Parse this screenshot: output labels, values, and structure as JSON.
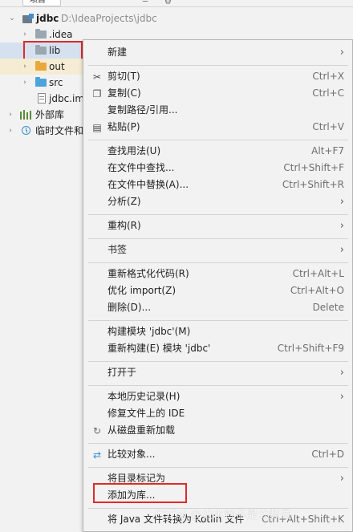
{
  "project": {
    "tab_label": "项目",
    "root": {
      "name": "jdbc",
      "path": "D:\\IdeaProjects\\jdbc"
    },
    "items": [
      {
        "label": ".idea"
      },
      {
        "label": "lib"
      },
      {
        "label": "out"
      },
      {
        "label": "src"
      },
      {
        "label": "jdbc.im"
      }
    ],
    "external_libs": "外部库",
    "scratches": "临时文件和"
  },
  "context_menu": {
    "items": [
      {
        "label": "新建"
      },
      {
        "label": "剪切(T)",
        "shortcut": "Ctrl+X"
      },
      {
        "label": "复制(C)",
        "shortcut": "Ctrl+C"
      },
      {
        "label": "复制路径/引用..."
      },
      {
        "label": "粘贴(P)",
        "shortcut": "Ctrl+V"
      },
      {
        "label": "查找用法(U)",
        "shortcut": "Alt+F7"
      },
      {
        "label": "在文件中查找...",
        "shortcut": "Ctrl+Shift+F"
      },
      {
        "label": "在文件中替换(A)...",
        "shortcut": "Ctrl+Shift+R"
      },
      {
        "label": "分析(Z)"
      },
      {
        "label": "重构(R)"
      },
      {
        "label": "书签"
      },
      {
        "label": "重新格式化代码(R)",
        "shortcut": "Ctrl+Alt+L"
      },
      {
        "label": "优化 import(Z)",
        "shortcut": "Ctrl+Alt+O"
      },
      {
        "label": "删除(D)...",
        "shortcut": "Delete"
      },
      {
        "label": "构建模块 'jdbc'(M)"
      },
      {
        "label": "重新构建(E) 模块 'jdbc'",
        "shortcut": "Ctrl+Shift+F9"
      },
      {
        "label": "打开于"
      },
      {
        "label": "本地历史记录(H)"
      },
      {
        "label": "修复文件上的 IDE"
      },
      {
        "label": "从磁盘重新加载"
      },
      {
        "label": "比较对象...",
        "shortcut": "Ctrl+D"
      },
      {
        "label": "将目录标记为"
      },
      {
        "label": "添加为库..."
      },
      {
        "label": "将 Java 文件转换为 Kotlin 文件",
        "shortcut": "Ctrl+Alt+Shift+K"
      }
    ]
  },
  "watermark": "CSDN @公水岭不是公数岳"
}
